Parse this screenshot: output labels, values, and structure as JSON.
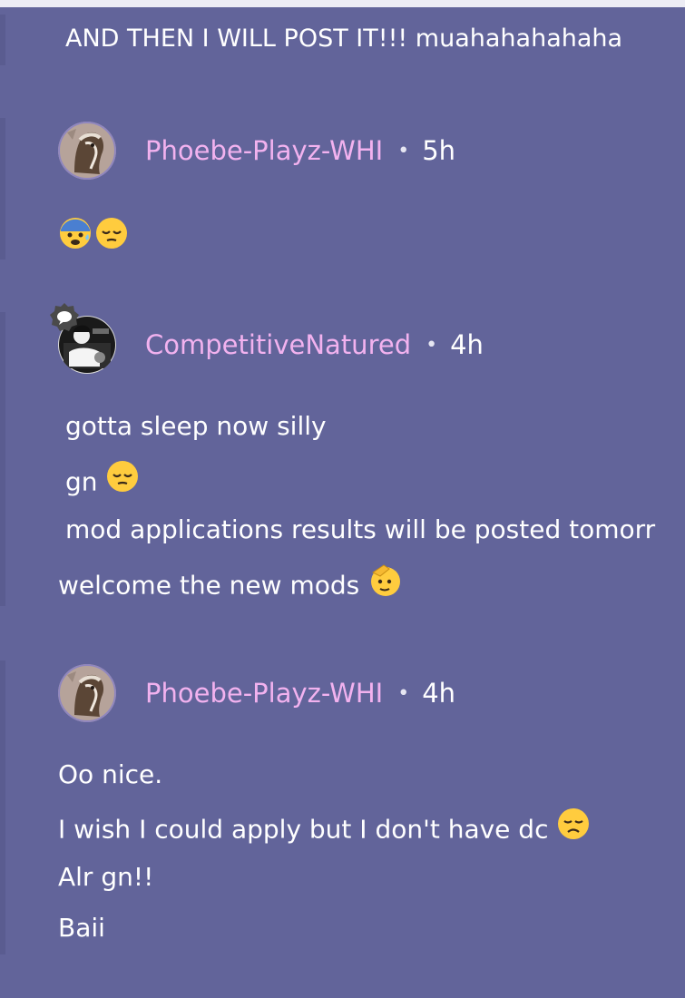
{
  "thread": {
    "intro_line": "AND THEN I WILL POST IT!!! muahahahahaha",
    "comments": [
      {
        "username": "Phoebe-Playz-WHI",
        "separator": "•",
        "time": "5h",
        "avatar_icon": "horse-avatar",
        "lines": [],
        "emoji": [
          "anxious-sweat-face-emoji",
          "relieved-face-emoji"
        ]
      },
      {
        "username": "CompetitiveNatured",
        "separator": "•",
        "time": "4h",
        "avatar_icon": "photo-avatar",
        "badge_icon": "comment-badge-icon",
        "lines": [
          "gotta sleep now silly",
          "gn",
          "mod applications results will be posted tomorr",
          "welcome the new mods"
        ]
      },
      {
        "username": "Phoebe-Playz-WHI",
        "separator": "•",
        "time": "4h",
        "avatar_icon": "horse-avatar",
        "lines": [
          "Oo nice.",
          "I wish I could apply but I don't have dc",
          "Alr gn!!",
          "Baii"
        ]
      }
    ]
  },
  "colors": {
    "background": "#62649a",
    "username": "#f2b2ef",
    "text": "#ffffff"
  }
}
